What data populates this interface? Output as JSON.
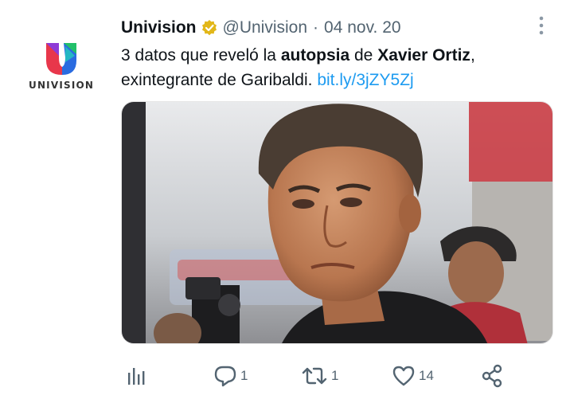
{
  "account": {
    "name": "Univision",
    "handle": "@Univision",
    "separator": "·",
    "date": "04 nov. 20",
    "logo_wordmark": "UNIVISION",
    "verified": true
  },
  "tweet": {
    "text_1": "3 datos que reveló la ",
    "bold_1": "autopsia",
    "text_2": " de ",
    "bold_2": "Xavier Ortiz",
    "text_3": ",",
    "text_4": "exintegrante de Garibaldi. ",
    "link": "bit.ly/3jZY5Zj"
  },
  "actions": {
    "stats": "",
    "replies": "1",
    "retweets": "1",
    "likes": "14"
  },
  "colors": {
    "link": "#1d9bf0",
    "secondary": "#536471",
    "verified_badge": "#e2b719"
  },
  "icons": [
    "univision-logo",
    "verified-icon",
    "more-icon",
    "stats-icon",
    "reply-icon",
    "retweet-icon",
    "like-icon",
    "share-icon"
  ]
}
